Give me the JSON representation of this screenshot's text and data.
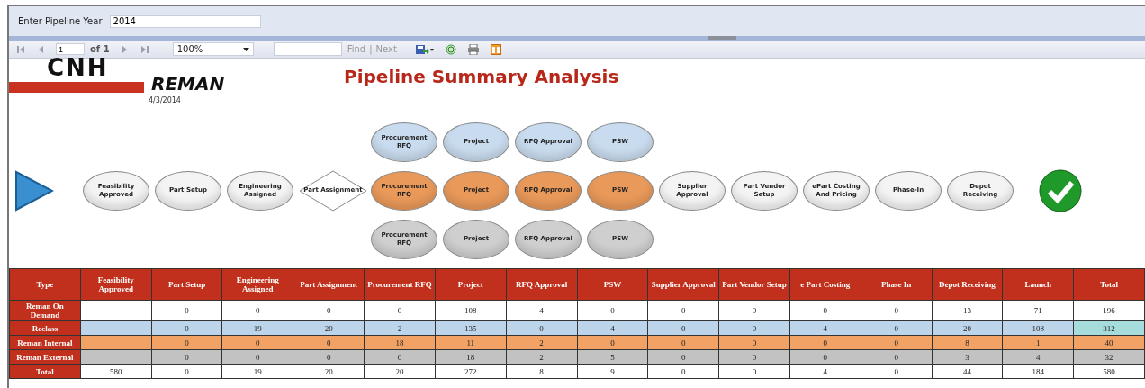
{
  "parameters": {
    "label": "Enter Pipeline Year",
    "value": "2014"
  },
  "toolbar": {
    "page": "1",
    "page_count": "of 1",
    "zoom": "100%",
    "find": "Find",
    "separator": "|",
    "next": "Next"
  },
  "report": {
    "logo": {
      "top": "CNH",
      "bottom": "REMAN"
    },
    "date": "4/3/2014",
    "title": "Pipeline Summary Analysis",
    "flow": [
      {
        "kind": "start"
      },
      {
        "kind": "step",
        "label": "Feasibility Approved"
      },
      {
        "kind": "step",
        "label": "Part Setup"
      },
      {
        "kind": "step",
        "label": "Engineering Assigned"
      },
      {
        "kind": "decision",
        "label": "Part Assignment"
      },
      {
        "kind": "parallel",
        "lanes": [
          {
            "label": "Procurement RFQ",
            "color": "#c9dbee"
          },
          {
            "label": "Procurement RFQ",
            "color": "#e9995a"
          },
          {
            "label": "Procurement RFQ",
            "color": "#cfcfcf"
          }
        ]
      },
      {
        "kind": "parallel",
        "lanes": [
          {
            "label": "Project",
            "color": "#c9dbee"
          },
          {
            "label": "Project",
            "color": "#e9995a"
          },
          {
            "label": "Project",
            "color": "#cfcfcf"
          }
        ]
      },
      {
        "kind": "parallel",
        "lanes": [
          {
            "label": "RFQ Approval",
            "color": "#c9dbee"
          },
          {
            "label": "RFQ Approval",
            "color": "#e9995a"
          },
          {
            "label": "RFQ Approval",
            "color": "#cfcfcf"
          }
        ]
      },
      {
        "kind": "parallel",
        "lanes": [
          {
            "label": "PSW",
            "color": "#c9dbee"
          },
          {
            "label": "PSW",
            "color": "#e9995a"
          },
          {
            "label": "PSW",
            "color": "#cfcfcf"
          }
        ]
      },
      {
        "kind": "step",
        "label": "Supplier Approval"
      },
      {
        "kind": "step",
        "label": "Part Vendor Setup"
      },
      {
        "kind": "step",
        "label": "ePart Costing And Pricing"
      },
      {
        "kind": "step",
        "label": "Phase-In"
      },
      {
        "kind": "step",
        "label": "Depot Receiving"
      },
      {
        "kind": "end"
      }
    ],
    "table": {
      "columns": [
        "Type",
        "Feasibility Approved",
        "Part Setup",
        "Engineering Assigned",
        "Part Assignment",
        "Procurement RFQ",
        "Project",
        "RFQ Approval",
        "PSW",
        "Supplier Approval",
        "Part Vendor Setup",
        "e Part Costing",
        "Phase In",
        "Depot Receiving",
        "Launch",
        "Total"
      ],
      "rows": [
        {
          "color": "#ffffff",
          "cells": [
            "Reman On Demand",
            "",
            "0",
            "0",
            "0",
            "0",
            "108",
            "4",
            "0",
            "0",
            "0",
            "0",
            "0",
            "13",
            "71",
            "196"
          ]
        },
        {
          "color": "#bdd5ea",
          "total_cell": {
            "color": "#a6dcdc"
          },
          "cells": [
            "Reclass",
            "",
            "0",
            "19",
            "20",
            "2",
            "135",
            "0",
            "4",
            "0",
            "0",
            "4",
            "0",
            "20",
            "108",
            "312"
          ]
        },
        {
          "color": "#f3a265",
          "cells": [
            "Reman Internal",
            "",
            "0",
            "0",
            "0",
            "18",
            "11",
            "2",
            "0",
            "0",
            "0",
            "0",
            "0",
            "8",
            "1",
            "40"
          ]
        },
        {
          "color": "#c2c2c2",
          "cells": [
            "Reman External",
            "",
            "0",
            "0",
            "0",
            "0",
            "18",
            "2",
            "5",
            "0",
            "0",
            "0",
            "0",
            "3",
            "4",
            "32"
          ]
        },
        {
          "color": "#ffffff",
          "cells": [
            "Total",
            "580",
            "0",
            "19",
            "20",
            "20",
            "272",
            "8",
            "9",
            "0",
            "0",
            "4",
            "0",
            "44",
            "184",
            "580"
          ]
        }
      ]
    }
  }
}
